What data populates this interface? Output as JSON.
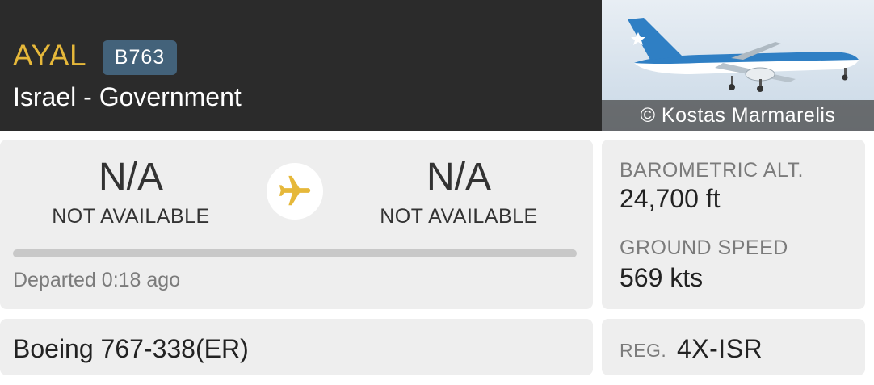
{
  "header": {
    "callsign": "AYAL",
    "type_code": "B763",
    "airline": "Israel - Government"
  },
  "photo": {
    "credit": "© Kostas Marmarelis"
  },
  "route": {
    "origin": {
      "code": "N/A",
      "city": "NOT AVAILABLE"
    },
    "destination": {
      "code": "N/A",
      "city": "NOT AVAILABLE"
    },
    "plane_icon": "airplane-icon",
    "progress_fraction": 0,
    "departed_text": "Departed 0:18 ago"
  },
  "stats": {
    "altitude_label": "BAROMETRIC ALT.",
    "altitude_value": "24,700 ft",
    "speed_label": "GROUND SPEED",
    "speed_value": "569 kts"
  },
  "aircraft": {
    "model": "Boeing 767-338(ER)",
    "reg_label": "REG.",
    "reg_value": "4X-ISR"
  },
  "colors": {
    "accent_yellow": "#e6b83a",
    "badge_blue": "#43627a",
    "header_bg": "#2b2b2b",
    "card_bg": "#eeeeee"
  }
}
